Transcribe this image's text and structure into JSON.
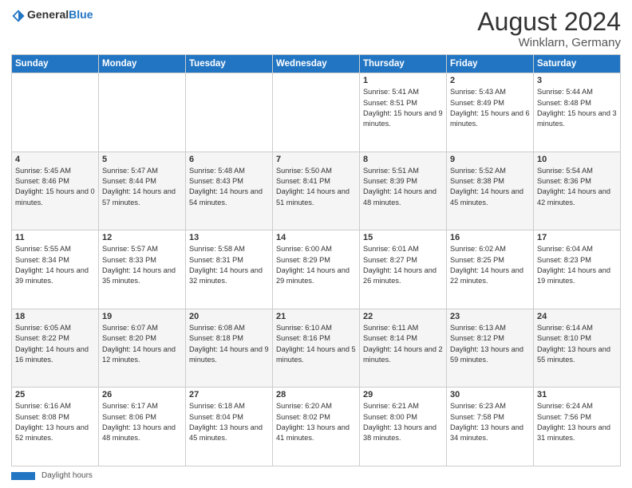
{
  "logo": {
    "general": "General",
    "blue": "Blue"
  },
  "header": {
    "title": "August 2024",
    "subtitle": "Winklarn, Germany"
  },
  "weekdays": [
    "Sunday",
    "Monday",
    "Tuesday",
    "Wednesday",
    "Thursday",
    "Friday",
    "Saturday"
  ],
  "footer": {
    "label": "Daylight hours"
  },
  "weeks": [
    [
      {
        "day": "",
        "sunrise": "",
        "sunset": "",
        "daylight": ""
      },
      {
        "day": "",
        "sunrise": "",
        "sunset": "",
        "daylight": ""
      },
      {
        "day": "",
        "sunrise": "",
        "sunset": "",
        "daylight": ""
      },
      {
        "day": "",
        "sunrise": "",
        "sunset": "",
        "daylight": ""
      },
      {
        "day": "1",
        "sunrise": "Sunrise: 5:41 AM",
        "sunset": "Sunset: 8:51 PM",
        "daylight": "Daylight: 15 hours and 9 minutes."
      },
      {
        "day": "2",
        "sunrise": "Sunrise: 5:43 AM",
        "sunset": "Sunset: 8:49 PM",
        "daylight": "Daylight: 15 hours and 6 minutes."
      },
      {
        "day": "3",
        "sunrise": "Sunrise: 5:44 AM",
        "sunset": "Sunset: 8:48 PM",
        "daylight": "Daylight: 15 hours and 3 minutes."
      }
    ],
    [
      {
        "day": "4",
        "sunrise": "Sunrise: 5:45 AM",
        "sunset": "Sunset: 8:46 PM",
        "daylight": "Daylight: 15 hours and 0 minutes."
      },
      {
        "day": "5",
        "sunrise": "Sunrise: 5:47 AM",
        "sunset": "Sunset: 8:44 PM",
        "daylight": "Daylight: 14 hours and 57 minutes."
      },
      {
        "day": "6",
        "sunrise": "Sunrise: 5:48 AM",
        "sunset": "Sunset: 8:43 PM",
        "daylight": "Daylight: 14 hours and 54 minutes."
      },
      {
        "day": "7",
        "sunrise": "Sunrise: 5:50 AM",
        "sunset": "Sunset: 8:41 PM",
        "daylight": "Daylight: 14 hours and 51 minutes."
      },
      {
        "day": "8",
        "sunrise": "Sunrise: 5:51 AM",
        "sunset": "Sunset: 8:39 PM",
        "daylight": "Daylight: 14 hours and 48 minutes."
      },
      {
        "day": "9",
        "sunrise": "Sunrise: 5:52 AM",
        "sunset": "Sunset: 8:38 PM",
        "daylight": "Daylight: 14 hours and 45 minutes."
      },
      {
        "day": "10",
        "sunrise": "Sunrise: 5:54 AM",
        "sunset": "Sunset: 8:36 PM",
        "daylight": "Daylight: 14 hours and 42 minutes."
      }
    ],
    [
      {
        "day": "11",
        "sunrise": "Sunrise: 5:55 AM",
        "sunset": "Sunset: 8:34 PM",
        "daylight": "Daylight: 14 hours and 39 minutes."
      },
      {
        "day": "12",
        "sunrise": "Sunrise: 5:57 AM",
        "sunset": "Sunset: 8:33 PM",
        "daylight": "Daylight: 14 hours and 35 minutes."
      },
      {
        "day": "13",
        "sunrise": "Sunrise: 5:58 AM",
        "sunset": "Sunset: 8:31 PM",
        "daylight": "Daylight: 14 hours and 32 minutes."
      },
      {
        "day": "14",
        "sunrise": "Sunrise: 6:00 AM",
        "sunset": "Sunset: 8:29 PM",
        "daylight": "Daylight: 14 hours and 29 minutes."
      },
      {
        "day": "15",
        "sunrise": "Sunrise: 6:01 AM",
        "sunset": "Sunset: 8:27 PM",
        "daylight": "Daylight: 14 hours and 26 minutes."
      },
      {
        "day": "16",
        "sunrise": "Sunrise: 6:02 AM",
        "sunset": "Sunset: 8:25 PM",
        "daylight": "Daylight: 14 hours and 22 minutes."
      },
      {
        "day": "17",
        "sunrise": "Sunrise: 6:04 AM",
        "sunset": "Sunset: 8:23 PM",
        "daylight": "Daylight: 14 hours and 19 minutes."
      }
    ],
    [
      {
        "day": "18",
        "sunrise": "Sunrise: 6:05 AM",
        "sunset": "Sunset: 8:22 PM",
        "daylight": "Daylight: 14 hours and 16 minutes."
      },
      {
        "day": "19",
        "sunrise": "Sunrise: 6:07 AM",
        "sunset": "Sunset: 8:20 PM",
        "daylight": "Daylight: 14 hours and 12 minutes."
      },
      {
        "day": "20",
        "sunrise": "Sunrise: 6:08 AM",
        "sunset": "Sunset: 8:18 PM",
        "daylight": "Daylight: 14 hours and 9 minutes."
      },
      {
        "day": "21",
        "sunrise": "Sunrise: 6:10 AM",
        "sunset": "Sunset: 8:16 PM",
        "daylight": "Daylight: 14 hours and 5 minutes."
      },
      {
        "day": "22",
        "sunrise": "Sunrise: 6:11 AM",
        "sunset": "Sunset: 8:14 PM",
        "daylight": "Daylight: 14 hours and 2 minutes."
      },
      {
        "day": "23",
        "sunrise": "Sunrise: 6:13 AM",
        "sunset": "Sunset: 8:12 PM",
        "daylight": "Daylight: 13 hours and 59 minutes."
      },
      {
        "day": "24",
        "sunrise": "Sunrise: 6:14 AM",
        "sunset": "Sunset: 8:10 PM",
        "daylight": "Daylight: 13 hours and 55 minutes."
      }
    ],
    [
      {
        "day": "25",
        "sunrise": "Sunrise: 6:16 AM",
        "sunset": "Sunset: 8:08 PM",
        "daylight": "Daylight: 13 hours and 52 minutes."
      },
      {
        "day": "26",
        "sunrise": "Sunrise: 6:17 AM",
        "sunset": "Sunset: 8:06 PM",
        "daylight": "Daylight: 13 hours and 48 minutes."
      },
      {
        "day": "27",
        "sunrise": "Sunrise: 6:18 AM",
        "sunset": "Sunset: 8:04 PM",
        "daylight": "Daylight: 13 hours and 45 minutes."
      },
      {
        "day": "28",
        "sunrise": "Sunrise: 6:20 AM",
        "sunset": "Sunset: 8:02 PM",
        "daylight": "Daylight: 13 hours and 41 minutes."
      },
      {
        "day": "29",
        "sunrise": "Sunrise: 6:21 AM",
        "sunset": "Sunset: 8:00 PM",
        "daylight": "Daylight: 13 hours and 38 minutes."
      },
      {
        "day": "30",
        "sunrise": "Sunrise: 6:23 AM",
        "sunset": "Sunset: 7:58 PM",
        "daylight": "Daylight: 13 hours and 34 minutes."
      },
      {
        "day": "31",
        "sunrise": "Sunrise: 6:24 AM",
        "sunset": "Sunset: 7:56 PM",
        "daylight": "Daylight: 13 hours and 31 minutes."
      }
    ]
  ]
}
